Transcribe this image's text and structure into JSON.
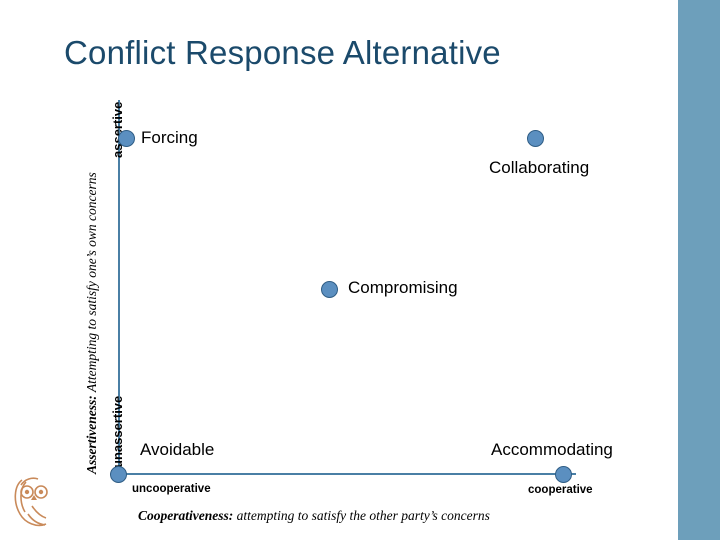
{
  "slide": {
    "title": "Conflict Response Alternative",
    "background_color": "#ffffff",
    "accent_color": "#6d9fbb",
    "title_color": "#1b4a6b"
  },
  "axes": {
    "vertical": {
      "label": "Assertiveness: Attempting to satisfy one's own concerns",
      "label_bold_part": "Assertiveness:",
      "top_end": "assertive",
      "bottom_end": "unassertive",
      "color": "#4a7fa5"
    },
    "horizontal": {
      "label": "Cooperativeness: attempting to satisfy the other party's concerns",
      "label_bold_part": "Cooperativeness:",
      "left_end": "uncooperative",
      "right_end": "cooperative",
      "color": "#4a7fa5"
    }
  },
  "nodes": [
    {
      "id": "forcing",
      "label": "Forcing",
      "dot_color": "#5b8fc0"
    },
    {
      "id": "collaborating",
      "label": "Collaborating",
      "dot_color": "#5b8fc0"
    },
    {
      "id": "compromising",
      "label": "Compromising",
      "dot_color": "#5b8fc0"
    },
    {
      "id": "avoidable",
      "label": "Avoidable",
      "dot_color": "#5b8fc0"
    },
    {
      "id": "accommodating",
      "label": "Accommodating",
      "dot_color": "#5b8fc0"
    }
  ],
  "icons": {
    "owl": "owl-logo"
  }
}
